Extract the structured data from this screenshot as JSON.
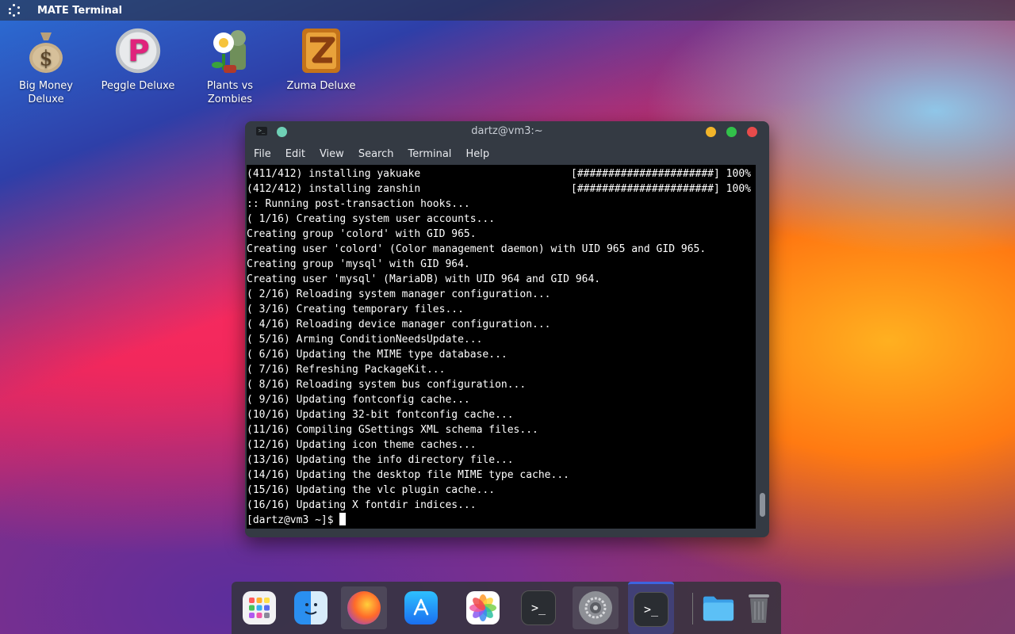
{
  "topbar": {
    "app_title": "MATE Terminal",
    "menu_icon": "apps-icon"
  },
  "desktop_icons": [
    {
      "label_line1": "Big Money",
      "label_line2": "Deluxe"
    },
    {
      "label_line1": "Peggle Deluxe",
      "label_line2": ""
    },
    {
      "label_line1": "Plants vs",
      "label_line2": "Zombies"
    },
    {
      "label_line1": "Zuma Deluxe",
      "label_line2": ""
    }
  ],
  "window": {
    "title": "dartz@vm3:~",
    "menu": [
      "File",
      "Edit",
      "View",
      "Search",
      "Terminal",
      "Help"
    ],
    "lines": [
      {
        "text": "(411/412) installing yakuake",
        "progress": "[######################] 100%"
      },
      {
        "text": "(412/412) installing zanshin",
        "progress": "[######################] 100%"
      },
      {
        "text": ":: Running post-transaction hooks...",
        "progress": ""
      },
      {
        "text": "( 1/16) Creating system user accounts...",
        "progress": ""
      },
      {
        "text": "Creating group 'colord' with GID 965.",
        "progress": ""
      },
      {
        "text": "Creating user 'colord' (Color management daemon) with UID 965 and GID 965.",
        "progress": ""
      },
      {
        "text": "Creating group 'mysql' with GID 964.",
        "progress": ""
      },
      {
        "text": "Creating user 'mysql' (MariaDB) with UID 964 and GID 964.",
        "progress": ""
      },
      {
        "text": "( 2/16) Reloading system manager configuration...",
        "progress": ""
      },
      {
        "text": "( 3/16) Creating temporary files...",
        "progress": ""
      },
      {
        "text": "( 4/16) Reloading device manager configuration...",
        "progress": ""
      },
      {
        "text": "( 5/16) Arming ConditionNeedsUpdate...",
        "progress": ""
      },
      {
        "text": "( 6/16) Updating the MIME type database...",
        "progress": ""
      },
      {
        "text": "( 7/16) Refreshing PackageKit...",
        "progress": ""
      },
      {
        "text": "( 8/16) Reloading system bus configuration...",
        "progress": ""
      },
      {
        "text": "( 9/16) Updating fontconfig cache...",
        "progress": ""
      },
      {
        "text": "(10/16) Updating 32-bit fontconfig cache...",
        "progress": ""
      },
      {
        "text": "(11/16) Compiling GSettings XML schema files...",
        "progress": ""
      },
      {
        "text": "(12/16) Updating icon theme caches...",
        "progress": ""
      },
      {
        "text": "(13/16) Updating the info directory file...",
        "progress": ""
      },
      {
        "text": "(14/16) Updating the desktop file MIME type cache...",
        "progress": ""
      },
      {
        "text": "(15/16) Updating the vlc plugin cache...",
        "progress": ""
      },
      {
        "text": "(16/16) Updating X fontdir indices...",
        "progress": ""
      }
    ],
    "prompt": "[dartz@vm3 ~]$ "
  },
  "dock": {
    "items": [
      "launchpad-icon",
      "finder-icon",
      "firefox-icon",
      "app-store-icon",
      "photos-icon",
      "terminal-icon",
      "settings-icon",
      "terminal-icon",
      "folder-icon",
      "trash-icon"
    ]
  },
  "colors": {
    "close": "#e84b4b",
    "maximize": "#32c14a",
    "minimize": "#f2b52a",
    "extra": "#6fd0b6"
  }
}
